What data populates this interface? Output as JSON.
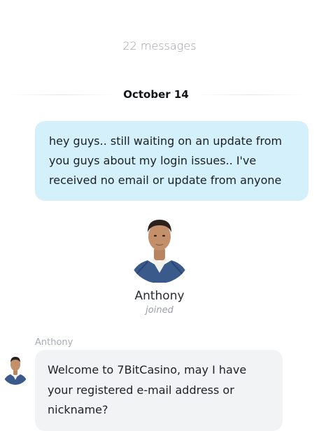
{
  "chat": {
    "message_count": "22 messages",
    "date_divider": "October 14",
    "outgoing_message": "hey guys.. still waiting on an update from you guys about my login issues.. I've received no email or update from anyone",
    "join_event": {
      "name": "Anthony",
      "status": "joined"
    },
    "incoming": {
      "sender": "Anthony",
      "message": "Welcome to 7BitCasino, may I have your registered e-mail address or nickname?"
    }
  },
  "colors": {
    "outgoing_bubble": "#d4f0fb",
    "incoming_bubble": "#f2f3f5",
    "muted_text": "#9a9ea5"
  },
  "icons": {
    "agent_avatar": "agent-avatar-photo"
  }
}
